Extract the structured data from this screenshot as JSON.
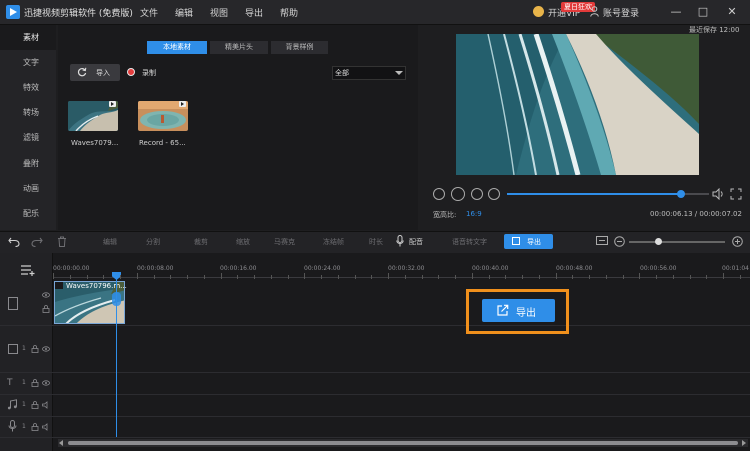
{
  "titlebar": {
    "app_title": "迅捷视频剪辑软件 (免费版)",
    "menu": [
      "文件",
      "编辑",
      "视图",
      "导出",
      "帮助"
    ],
    "vip_label": "开通VIP",
    "vip_badge": "夏日狂欢",
    "login_label": "账号登录",
    "win_minimize": "—",
    "win_maximize": "□",
    "win_close": "✕"
  },
  "leftnav": {
    "items": [
      "素材",
      "文字",
      "特效",
      "转场",
      "滤镜",
      "叠附",
      "动画",
      "配乐"
    ],
    "active_index": 0
  },
  "media": {
    "tabs": [
      "本地素材",
      "精美片头",
      "背景样例"
    ],
    "active_tab": 0,
    "import_label": "导入",
    "record_label": "录制",
    "filter_value": "全部",
    "items": [
      {
        "label": "Waves7079..."
      },
      {
        "label": "Record - 65..."
      }
    ]
  },
  "preview": {
    "autosave": "最近保存 12:00",
    "ratio_label": "宽高比:",
    "ratio_value": "16:9",
    "time_current": "00:00:06.13 / 00:00:07.02",
    "progress": 0.86
  },
  "toolbar": {
    "tools": [
      "编辑",
      "分割",
      "裁剪",
      "缩放",
      "马赛克",
      "冻结帧",
      "时长",
      "配音",
      "语音转文字"
    ],
    "export_label": "导出",
    "zoom_level": 0.3
  },
  "timeline": {
    "ticks": [
      "00:00:00.00",
      "00:00:08.00",
      "00:00:16.00",
      "00:00:24.00",
      "00:00:32.00",
      "00:00:40.00",
      "00:00:48.00",
      "00:00:56.00",
      "00:01:04"
    ],
    "clip_label": "Waves70796.m...",
    "track_nums": [
      "1",
      "1",
      "1",
      "1"
    ],
    "export_button_label": "导出"
  },
  "colors": {
    "accent": "#2f8ee8",
    "highlight": "#f0901c",
    "record": "#e53d3d",
    "vip_badge": "#e23a3a"
  }
}
